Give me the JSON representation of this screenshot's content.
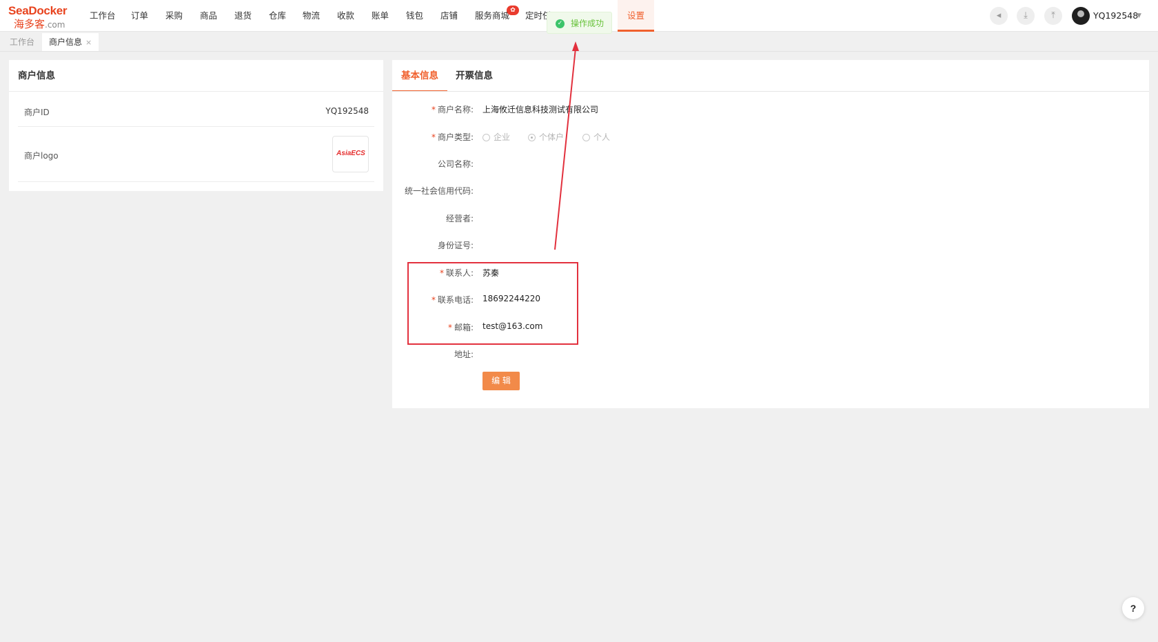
{
  "brand": {
    "name_en": "SeaDocker",
    "name_cn": "海多客",
    "suffix": ".com"
  },
  "nav": {
    "items": [
      "工作台",
      "订单",
      "采购",
      "商品",
      "退货",
      "仓库",
      "物流",
      "收款",
      "账单",
      "钱包",
      "店铺",
      "服务商城",
      "定时任"
    ],
    "active_label": "设置",
    "badge_icon": "gift-icon"
  },
  "header": {
    "icons": [
      "megaphone-icon",
      "download-icon",
      "upload-icon"
    ],
    "username": "YQ192548"
  },
  "page_tabs": [
    {
      "label": "工作台"
    },
    {
      "label": "商户信息",
      "close": "×"
    }
  ],
  "merchant_card": {
    "title": "商户信息",
    "id_label": "商户ID",
    "id_value": "YQ192548",
    "logo_label": "商户logo",
    "logo_text": "AsiaECS"
  },
  "detail_card": {
    "tabs": [
      "基本信息",
      "开票信息"
    ],
    "fields": {
      "merchant_name": {
        "label": "商户名称:",
        "value": "上海攸迁信息科技测试有限公司"
      },
      "merchant_type": {
        "label": "商户类型:",
        "options": [
          "企业",
          "个体户",
          "个人"
        ],
        "selected": "个体户"
      },
      "company_name": {
        "label": "公司名称:"
      },
      "credit_code": {
        "label": "统一社会信用代码:"
      },
      "operator": {
        "label": "经营者:"
      },
      "id_number": {
        "label": "身份证号:"
      },
      "contact": {
        "label": "联系人:",
        "value": "苏秦"
      },
      "phone": {
        "label": "联系电话:",
        "value": "18692244220"
      },
      "email": {
        "label": "邮箱:",
        "value": "test@163.com"
      },
      "address": {
        "label": "地址:"
      }
    },
    "required_mark": "*",
    "edit_label": "编 辑"
  },
  "toast": {
    "message": "操作成功"
  },
  "help": {
    "label": "?"
  },
  "colors": {
    "accent": "#f0602d",
    "annotation": "#e2303d",
    "success": "#3cc46a"
  }
}
